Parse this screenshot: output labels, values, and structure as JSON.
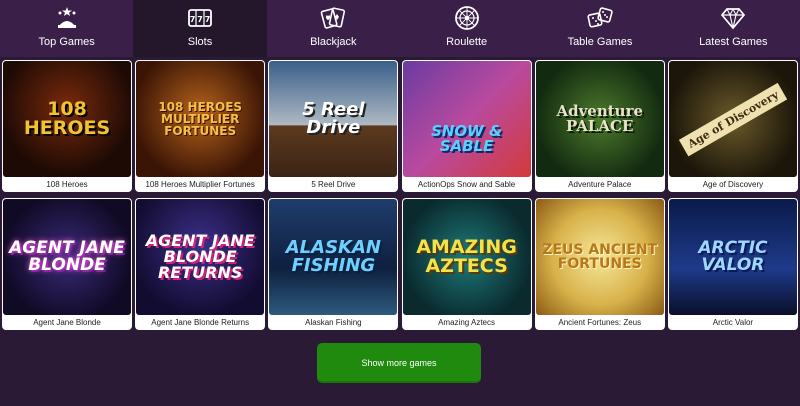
{
  "nav": {
    "items": [
      {
        "label": "Top Games",
        "icon": "stars-hat-icon"
      },
      {
        "label": "Slots",
        "icon": "slot-777-icon",
        "active": true
      },
      {
        "label": "Blackjack",
        "icon": "playing-cards-icon"
      },
      {
        "label": "Roulette",
        "icon": "roulette-wheel-icon"
      },
      {
        "label": "Table Games",
        "icon": "dice-icon"
      },
      {
        "label": "Latest Games",
        "icon": "diamond-icon"
      }
    ]
  },
  "games": [
    {
      "title": "108 Heroes",
      "art_text": "108 HEROES",
      "accent": "#f2c230"
    },
    {
      "title": "108 Heroes Multiplier Fortunes",
      "art_text": "108 HEROES MULTIPLIER FORTUNES",
      "accent": "#f5c046"
    },
    {
      "title": "5 Reel Drive",
      "art_text": "5 Reel Drive",
      "accent": "#ffffff"
    },
    {
      "title": "ActionOps Snow and Sable",
      "art_text": "SNOW & SABLE",
      "accent": "#5ad0ff"
    },
    {
      "title": "Adventure Palace",
      "art_text": "Adventure PALACE",
      "accent": "#e8e2c8"
    },
    {
      "title": "Age of Discovery",
      "art_text": "Age of Discovery",
      "accent": "#f0e2b0"
    },
    {
      "title": "Agent Jane Blonde",
      "art_text": "AGENT JANE BLONDE",
      "accent": "#ff5ad2"
    },
    {
      "title": "Agent Jane Blonde Returns",
      "art_text": "AGENT JANE BLONDE RETURNS",
      "accent": "#ffffff"
    },
    {
      "title": "Alaskan Fishing",
      "art_text": "ALASKAN FISHING",
      "accent": "#6fd0ff"
    },
    {
      "title": "Amazing Aztecs",
      "art_text": "AMAZING AZTECS",
      "accent": "#f2e34a"
    },
    {
      "title": "Ancient Fortunes: Zeus",
      "art_text": "ZEUS ANCIENT FORTUNES",
      "accent": "#b6781a"
    },
    {
      "title": "Arctic Valor",
      "art_text": "ARCTIC VALOR",
      "accent": "#9fd8ff"
    }
  ],
  "show_more_label": "Show more games",
  "colors": {
    "nav_bg": "#3a1f48",
    "nav_active_bg": "#24172c",
    "page_bg": "#2a1a35",
    "button_green": "#1f8a0e"
  }
}
